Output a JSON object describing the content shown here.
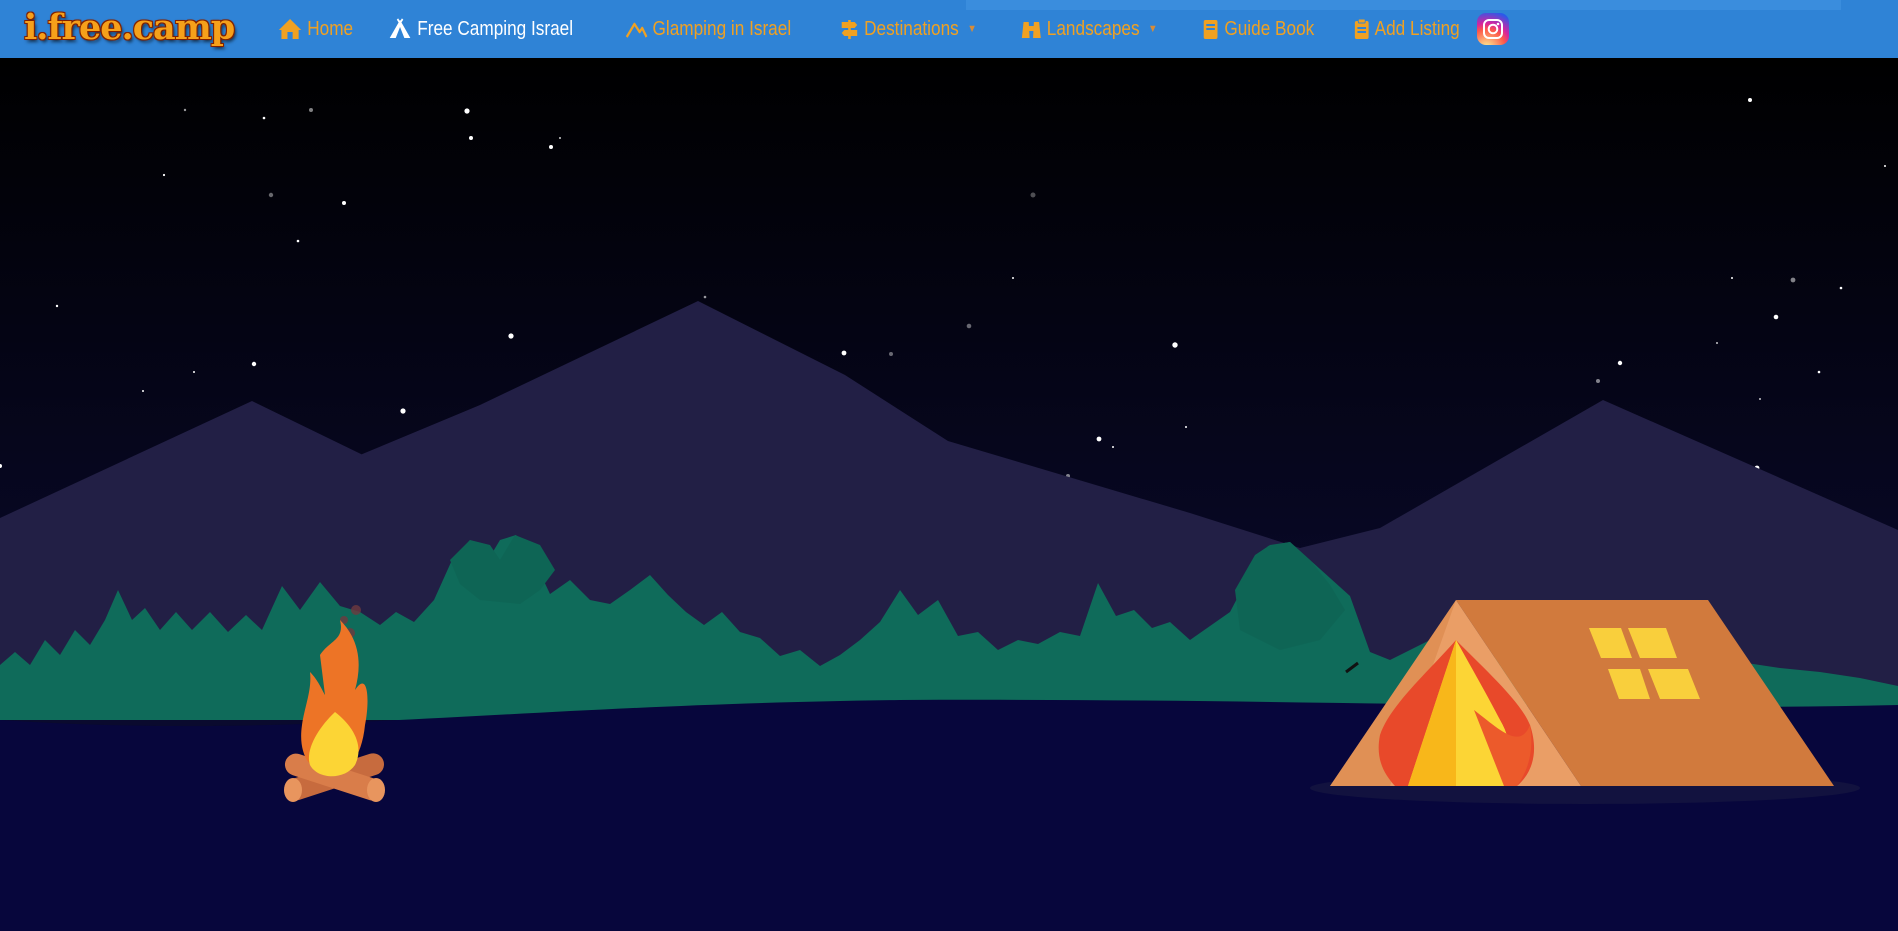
{
  "header": {
    "logo_text": "i.free.camp",
    "nav": [
      {
        "label": "Home",
        "icon": "home-icon"
      },
      {
        "label": "Free Camping Israel",
        "icon": "tent-icon",
        "active": true
      },
      {
        "label": "Glamping in Israel",
        "icon": "glamping-icon"
      },
      {
        "label": "Destinations",
        "icon": "signpost-icon",
        "has_dropdown": true
      },
      {
        "label": "Landscapes",
        "icon": "binoculars-icon",
        "has_dropdown": true
      },
      {
        "label": "Guide Book",
        "icon": "book-icon"
      },
      {
        "label": "Add Listing",
        "icon": "clipboard-icon"
      }
    ],
    "social_icon": "instagram-icon"
  },
  "colors": {
    "nav_bg": "#2f83d6",
    "nav_text": "#f0a122",
    "nav_active": "#ffffff",
    "sky_top": "#000000",
    "sky_bottom": "#0b0b3a",
    "mountains": "#221f45",
    "trees": "#0f6b5a",
    "ground": "#07063c",
    "tent": "#d17a3d"
  }
}
